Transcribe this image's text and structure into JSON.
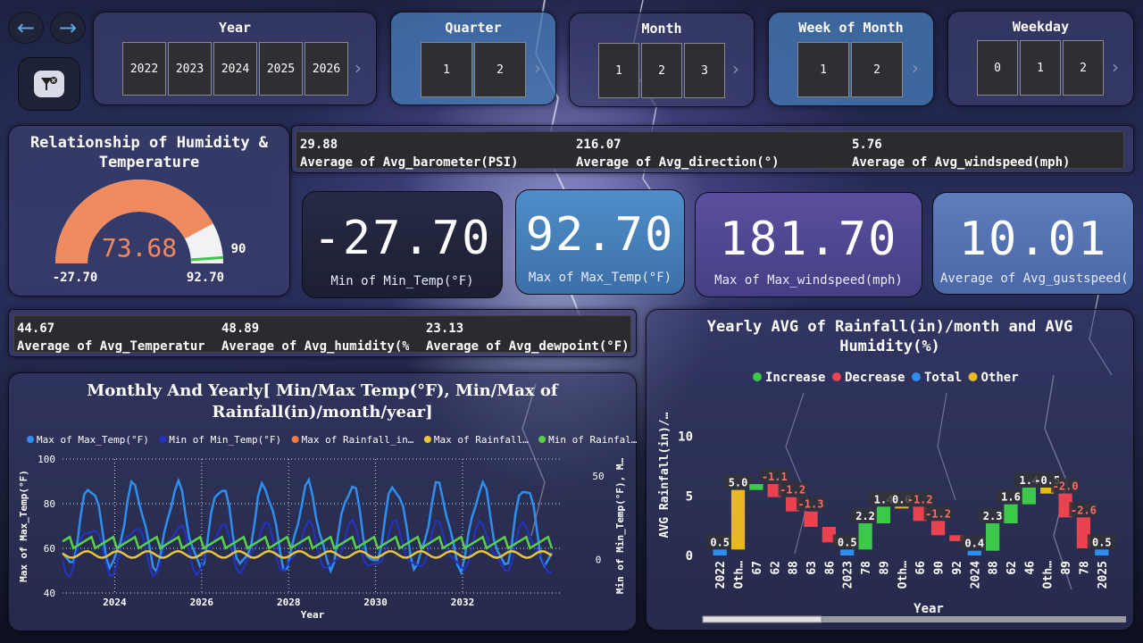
{
  "nav": {
    "back_icon": "arrow-left-icon",
    "forward_icon": "arrow-right-icon",
    "filter_icon": "filter-clear-icon"
  },
  "slicers": {
    "year": {
      "title": "Year",
      "options": [
        "2022",
        "2023",
        "2024",
        "2025",
        "2026"
      ]
    },
    "quarter": {
      "title": "Quarter",
      "options": [
        "1",
        "2"
      ]
    },
    "month": {
      "title": "Month",
      "options": [
        "1",
        "2",
        "3"
      ]
    },
    "week": {
      "title": "Week of Month",
      "options": [
        "1",
        "2"
      ]
    },
    "weekday": {
      "title": "Weekday",
      "options": [
        "0",
        "1",
        "2"
      ]
    }
  },
  "gauge": {
    "title_line1": "Relationship of Humidity &",
    "title_line2": "Temperature",
    "value": "73.68",
    "value_num": 73.68,
    "min": "-27.70",
    "max": "92.70",
    "min_num": -27.7,
    "max_num": 92.7,
    "target": "90",
    "target_num": 90,
    "fill_color": "#ef8b5f"
  },
  "stats_top": [
    {
      "value": "29.88",
      "label": "Average of Avg_barometer(PSI)"
    },
    {
      "value": "216.07",
      "label": "Average of Avg_direction(°)"
    },
    {
      "value": "5.76",
      "label": "Average of Avg_windspeed(mph)"
    }
  ],
  "kpis": [
    {
      "value": "-27.70",
      "label": "Min of Min_Temp(°F)"
    },
    {
      "value": "92.70",
      "label": "Max of Max_Temp(°F)"
    },
    {
      "value": "181.70",
      "label": "Max of Max_windspeed(mph)"
    },
    {
      "value": "10.01",
      "label": "Average of Avg_gustspeed(mph)"
    }
  ],
  "stats_mid": [
    {
      "value": "44.67",
      "label": "Average of Avg_Temperature(°F)"
    },
    {
      "value": "48.89",
      "label": "Average of Avg_humidity(%)"
    },
    {
      "value": "23.13",
      "label": "Average of Avg_dewpoint(°F)"
    }
  ],
  "line_chart": {
    "title_line1": "Monthly And Yearly[ Min/Max Temp(°F), Min/Max of",
    "title_line2": "Rainfall(in)/month/year]"
  },
  "waterfall": {
    "title_line1": "Yearly AVG of Rainfall(in)/month and AVG",
    "title_line2": "Humidity(%)"
  },
  "chart_data": [
    {
      "type": "line",
      "title": "Monthly And Yearly[ Min/Max Temp(°F), Min/Max of Rainfall(in)/month/year]",
      "xlabel": "Year",
      "ylabel": "Max of Max_Temp(°F)",
      "y2label": "Min of Min_Temp(°F), M…",
      "xlim": [
        2022.8,
        2034.3
      ],
      "ylim": [
        40,
        100
      ],
      "y2lim": [
        -20,
        60
      ],
      "x_ticks": [
        "2024",
        "2026",
        "2028",
        "2030",
        "2032"
      ],
      "y_ticks": [
        "40",
        "60",
        "80",
        "100"
      ],
      "y2_ticks": [
        "0",
        "50"
      ],
      "grid": true,
      "legend_position": "top",
      "series": [
        {
          "name": "Max of Max_Temp(°F)",
          "color": "#2f8ff0",
          "axis": "left"
        },
        {
          "name": "Min of Min_Temp(°F)",
          "color": "#2233c8",
          "axis": "left"
        },
        {
          "name": "Max of Rainfall_in…",
          "color": "#ef7b4a",
          "axis": "right"
        },
        {
          "name": "Max of Rainfall…",
          "color": "#e8c53a",
          "axis": "right"
        },
        {
          "name": "Min of Rainfal…",
          "color": "#5ad04a",
          "axis": "right"
        }
      ]
    },
    {
      "type": "bar",
      "subtype": "waterfall",
      "title": "Yearly AVG of Rainfall(in)/month and AVG Humidity(%)",
      "xlabel": "Year",
      "ylabel": "AVG Rainfall(in)/…",
      "ylim": [
        0,
        12
      ],
      "y_ticks": [
        "0",
        "5",
        "10"
      ],
      "legend": [
        {
          "name": "Increase",
          "color": "#3cc94a"
        },
        {
          "name": "Decrease",
          "color": "#e8434f"
        },
        {
          "name": "Total",
          "color": "#2f8ff0"
        },
        {
          "name": "Other",
          "color": "#e8b820"
        }
      ],
      "categories": [
        "2022",
        "Oth…",
        "67",
        "62",
        "88",
        "63",
        "86",
        "2023",
        "78",
        "89",
        "Oth…",
        "66",
        "90",
        "92",
        "2024",
        "88",
        "62",
        "46",
        "Oth…",
        "89",
        "78",
        "2025"
      ],
      "kinds": [
        "total",
        "other",
        "increase",
        "decrease",
        "decrease",
        "decrease",
        "decrease",
        "total",
        "increase",
        "increase",
        "other",
        "decrease",
        "decrease",
        "decrease",
        "total",
        "increase",
        "increase",
        "increase",
        "other",
        "decrease",
        "decrease",
        "total"
      ],
      "values": [
        0.5,
        5.0,
        0.5,
        -1.1,
        -1.2,
        -1.3,
        -1.3,
        0.5,
        2.2,
        1.4,
        0.0,
        -1.2,
        -1.2,
        -0.5,
        0.4,
        2.3,
        1.6,
        1.4,
        -0.5,
        -2.0,
        -2.6,
        0.5
      ],
      "labels": [
        "0.5",
        "5.0",
        "",
        "-1.1",
        "-1.2",
        "-1.3",
        "",
        "0.5",
        "2.2",
        "1.4",
        "0.0",
        "-1.2",
        "-1.2",
        "",
        "0.4",
        "2.3",
        "1.6",
        "1.4",
        "-0.5",
        "-2.0",
        "-2.6",
        "0.5"
      ]
    }
  ]
}
